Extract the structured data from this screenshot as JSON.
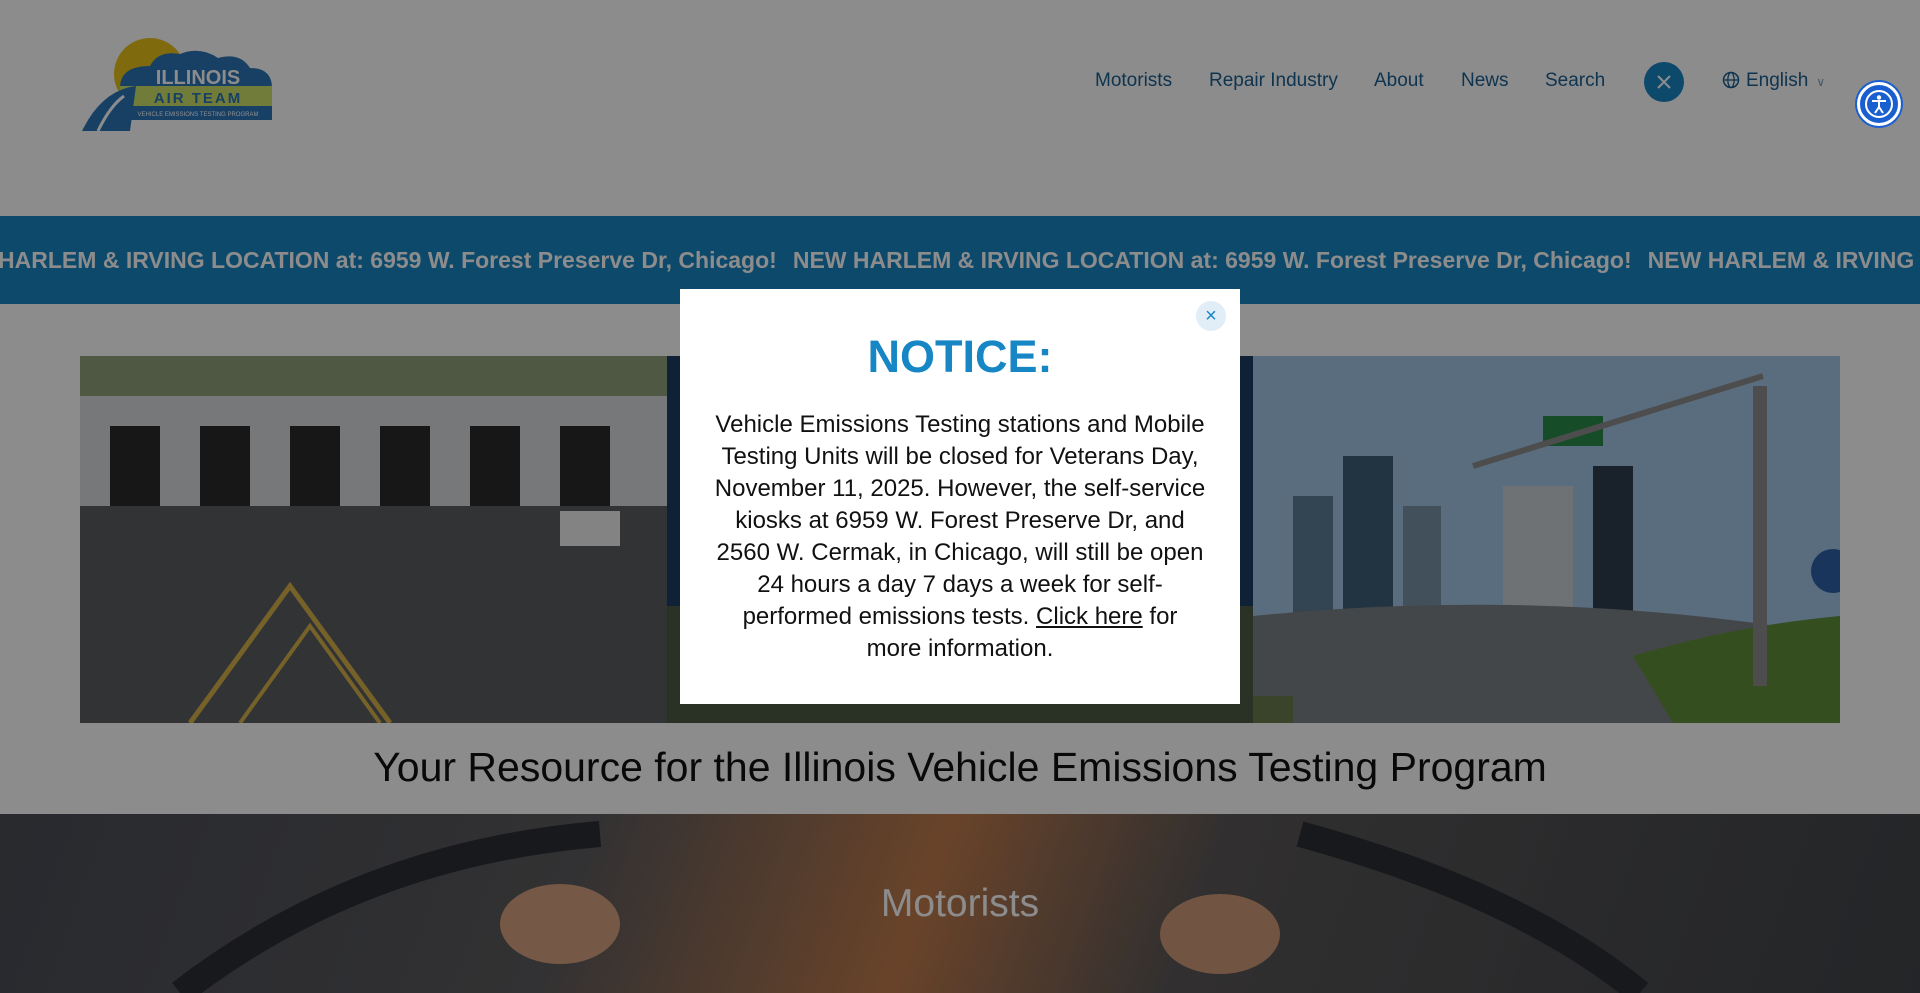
{
  "header": {
    "logo_top": "ILLINOIS",
    "logo_middle": "AIR TEAM",
    "logo_bottom": "VEHICLE EMISSIONS TESTING PROGRAM",
    "nav": [
      {
        "label": "Motorists"
      },
      {
        "label": "Repair Industry"
      },
      {
        "label": "About"
      },
      {
        "label": "News"
      },
      {
        "label": "Search"
      }
    ],
    "social_icon": "x-icon",
    "language": "English"
  },
  "ticker": {
    "message": "NEW HARLEM & IRVING LOCATION at: 6959 W. Forest Preserve Dr, Chicago!"
  },
  "tagline": "Your Resource for the Illinois Vehicle Emissions Testing Program",
  "motorists_section": {
    "title": "Motorists"
  },
  "modal": {
    "title": "NOTICE:",
    "body_before": "Vehicle Emissions Testing stations and Mobile Testing Units will be closed for Veterans Day, November 11, 2025. However, the self-service kiosks at 6959 W. Forest Preserve Dr, and 2560 W. Cermak, in Chicago, will still be open 24 hours a day 7 days a week for self-performed emissions tests.",
    "link_text": "Click here",
    "body_after": "for more information.",
    "close_symbol": "×"
  },
  "colors": {
    "brand_blue": "#1786c4",
    "nav_text": "#1b5f91",
    "overlay": "rgba(0,0,0,0.45)"
  }
}
